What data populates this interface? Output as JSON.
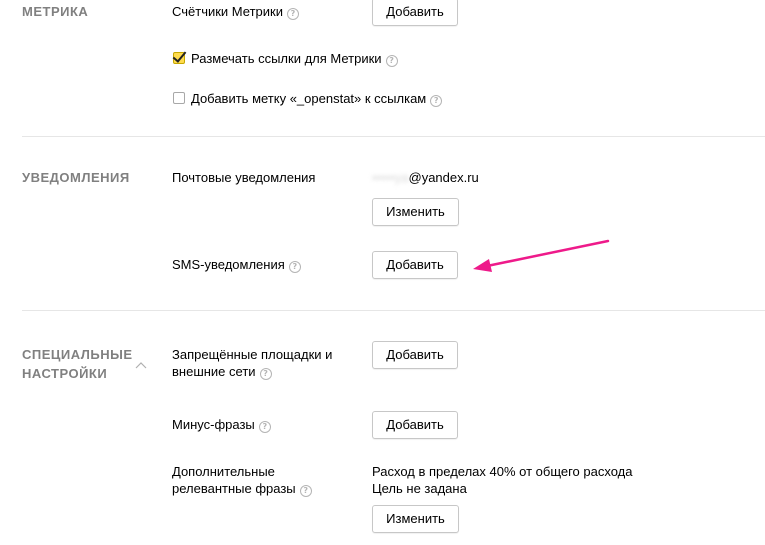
{
  "metrika": {
    "section_title": "МЕТРИКА",
    "counters_label": "Счётчики Метрики",
    "counters_button": "Добавить",
    "mark_links_label": "Размечать ссылки для Метрики",
    "mark_links_checked": true,
    "openstat_label": "Добавить метку «_openstat» к ссылкам",
    "openstat_checked": false
  },
  "notifications": {
    "section_title": "УВЕДОМЛЕНИЯ",
    "email_label": "Почтовые уведомления",
    "email_hidden_part": "•••••ya",
    "email_domain": "@yandex.ru",
    "email_change_button": "Изменить",
    "sms_label": "SMS-уведомления",
    "sms_button": "Добавить"
  },
  "special": {
    "section_title_line1": "СПЕЦИАЛЬНЫЕ",
    "section_title_line2": "НАСТРОЙКИ",
    "forbidden_label_line1": "Запрещённые площадки и",
    "forbidden_label_line2": "внешние сети",
    "forbidden_button": "Добавить",
    "minus_label": "Минус-фразы",
    "minus_button": "Добавить",
    "extra_label_line1": "Дополнительные",
    "extra_label_line2": "релевантные фразы",
    "extra_value_line1": "Расход в пределах 40% от общего расхода",
    "extra_value_line2": "Цель не задана",
    "extra_button": "Изменить"
  },
  "colors": {
    "annotation_arrow": "#ee1a8a",
    "checkbox_checked": "#ffdb4d"
  }
}
